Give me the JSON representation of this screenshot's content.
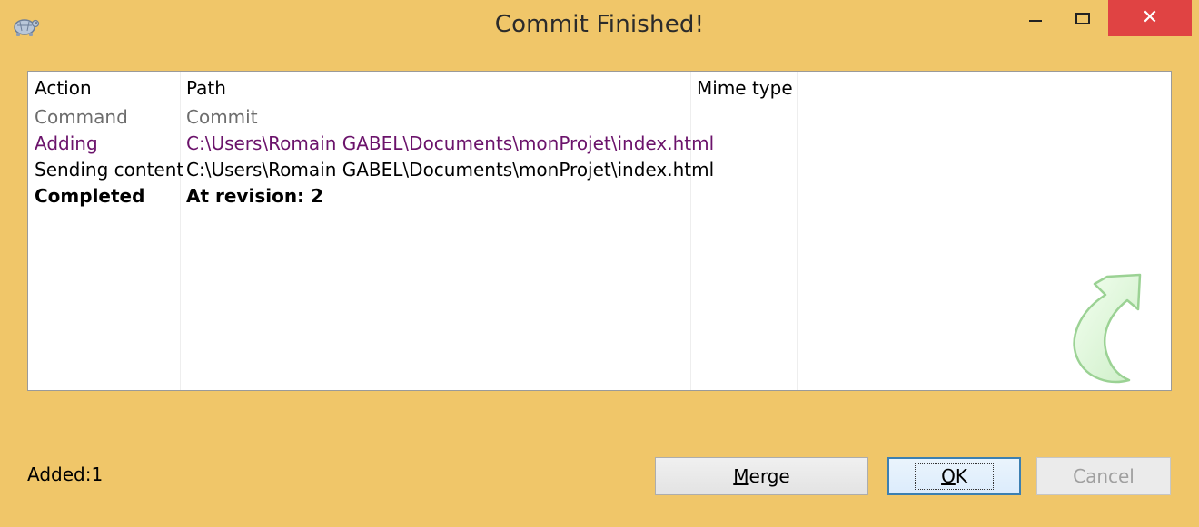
{
  "window": {
    "title": "Commit Finished!",
    "icon": "tortoise-icon"
  },
  "titlebar_buttons": {
    "close_glyph": "✕"
  },
  "list": {
    "columns": [
      "Action",
      "Path",
      "Mime type"
    ],
    "rows": [
      {
        "action": "Command",
        "path": "Commit",
        "style": "command"
      },
      {
        "action": "Adding",
        "path": "C:\\Users\\Romain GABEL\\Documents\\monProjet\\index.html",
        "style": "adding"
      },
      {
        "action": "Sending content",
        "path": "C:\\Users\\Romain GABEL\\Documents\\monProjet\\index.html",
        "style": "sending"
      },
      {
        "action": "Completed",
        "path": "At revision: 2",
        "style": "completed"
      }
    ],
    "watermark_icon": "green-curved-arrow-icon"
  },
  "status": {
    "text": "Added:1"
  },
  "buttons": {
    "merge": {
      "pre": "",
      "accel": "M",
      "post": "erge"
    },
    "ok": {
      "pre": "",
      "accel": "O",
      "post": "K"
    },
    "cancel": {
      "label": "Cancel"
    }
  },
  "colors": {
    "window_bg": "#F0C669",
    "close_bg": "#E04343",
    "adding_text": "#6B136B",
    "command_text": "#6D6D6D"
  }
}
